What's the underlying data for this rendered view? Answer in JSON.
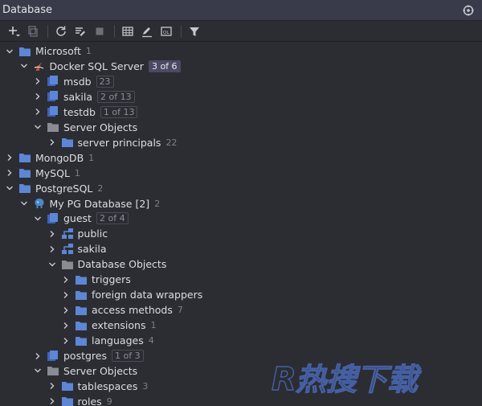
{
  "window": {
    "title": "Database"
  },
  "icons": {
    "gear": "gear-icon",
    "folder_color": "#5d86d6",
    "grey_folder_color": "#8a8c94"
  },
  "tree": [
    {
      "label": "Microsoft",
      "count": "1",
      "icon": "folder-icon",
      "level": 0,
      "chevron": "down"
    },
    {
      "label": "Docker SQL Server",
      "badge": "3 of 6",
      "badge_active": true,
      "icon": "sqlserver-icon",
      "level": 1,
      "chevron": "down"
    },
    {
      "label": "msdb",
      "badge": "23",
      "icon": "database-icon",
      "level": 2,
      "chevron": "right"
    },
    {
      "label": "sakila",
      "badge": "2 of 13",
      "icon": "database-icon",
      "level": 2,
      "chevron": "right"
    },
    {
      "label": "testdb",
      "badge": "1 of 13",
      "icon": "database-icon",
      "level": 2,
      "chevron": "right"
    },
    {
      "label": "Server Objects",
      "icon": "grey-folder-icon",
      "level": 2,
      "chevron": "down"
    },
    {
      "label": "server principals",
      "count": "22",
      "icon": "folder-icon",
      "level": 3,
      "chevron": "right"
    },
    {
      "label": "MongoDB",
      "count": "1",
      "icon": "folder-icon",
      "level": 0,
      "chevron": "right"
    },
    {
      "label": "MySQL",
      "count": "1",
      "icon": "folder-icon",
      "level": 0,
      "chevron": "right"
    },
    {
      "label": "PostgreSQL",
      "count": "2",
      "icon": "folder-icon",
      "level": 0,
      "chevron": "down"
    },
    {
      "label": "My PG Database [2]",
      "count": "2",
      "icon": "postgres-icon",
      "level": 1,
      "chevron": "down"
    },
    {
      "label": "guest",
      "badge": "2 of 4",
      "icon": "database-icon",
      "level": 2,
      "chevron": "down"
    },
    {
      "label": "public",
      "icon": "schema-icon",
      "level": 3,
      "chevron": "right"
    },
    {
      "label": "sakila",
      "icon": "schema-icon",
      "level": 3,
      "chevron": "right"
    },
    {
      "label": "Database Objects",
      "icon": "grey-folder-icon",
      "level": 3,
      "chevron": "down"
    },
    {
      "label": "triggers",
      "icon": "folder-icon",
      "level": 4,
      "chevron": "right"
    },
    {
      "label": "foreign data wrappers",
      "icon": "folder-icon",
      "level": 4,
      "chevron": "right"
    },
    {
      "label": "access methods",
      "count": "7",
      "icon": "folder-icon",
      "level": 4,
      "chevron": "right"
    },
    {
      "label": "extensions",
      "count": "1",
      "icon": "folder-icon",
      "level": 4,
      "chevron": "right"
    },
    {
      "label": "languages",
      "count": "4",
      "icon": "folder-icon",
      "level": 4,
      "chevron": "right"
    },
    {
      "label": "postgres",
      "badge": "1 of 3",
      "icon": "database-icon",
      "level": 2,
      "chevron": "right"
    },
    {
      "label": "Server Objects",
      "icon": "grey-folder-icon",
      "level": 2,
      "chevron": "down"
    },
    {
      "label": "tablespaces",
      "count": "3",
      "icon": "folder-icon",
      "level": 3,
      "chevron": "right"
    },
    {
      "label": "roles",
      "count": "9",
      "icon": "folder-icon",
      "level": 3,
      "chevron": "right"
    }
  ],
  "watermark": {
    "text": "R热搜下载"
  }
}
